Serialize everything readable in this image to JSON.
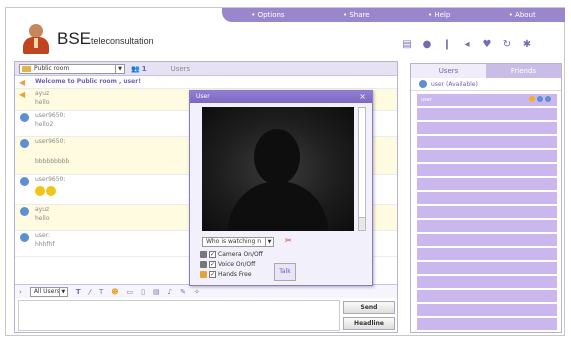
{
  "nav": {
    "options": "Options",
    "share": "Share",
    "help": "Help",
    "about": "About"
  },
  "logo": {
    "main": "BSE",
    "sub": "teleconsultation"
  },
  "room": {
    "selected": "Public room",
    "count": "1",
    "users_label": "Users"
  },
  "messages": [
    {
      "name": "Welcome to Public room , user!",
      "text": ""
    },
    {
      "name": "ayuz",
      "text": "hello"
    },
    {
      "name": "user9650:",
      "text": "hello2"
    },
    {
      "name": "user9650:",
      "text": "bbbbbbbbb"
    },
    {
      "name": "user9650:",
      "text": ""
    },
    {
      "name": "ayuz",
      "text": "hello"
    },
    {
      "name": "user:",
      "text": "hhhfhf"
    }
  ],
  "format": {
    "target": "All Users"
  },
  "buttons": {
    "send": "Send",
    "headline": "Headline"
  },
  "right": {
    "tab_users": "Users",
    "tab_friends": "Friends",
    "current_user": "user (Available)",
    "list_user": "user"
  },
  "popup": {
    "title": "User",
    "who": "Who is watching n",
    "camera": "Camera On/Off",
    "voice": "Voice On/Off",
    "hands": "Hands Free",
    "talk": "Talk"
  },
  "colors": {
    "accent": "#9a86cc",
    "list": "#c9b7ee"
  }
}
